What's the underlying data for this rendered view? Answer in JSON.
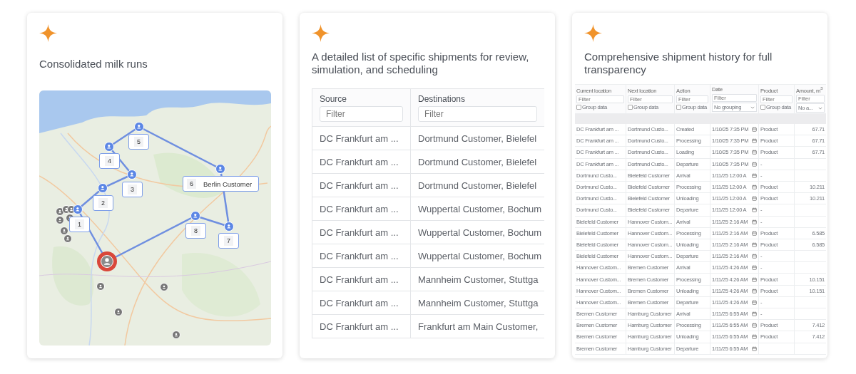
{
  "cards": [
    {
      "kind": "map",
      "title": "Consolidated milk runs",
      "map": {
        "stops": [
          {
            "label": "1"
          },
          {
            "label": "2"
          },
          {
            "label": "3"
          },
          {
            "label": "4"
          },
          {
            "label": "5"
          },
          {
            "label": "6",
            "name": "Berlin Customer"
          },
          {
            "label": "7"
          },
          {
            "label": "8"
          }
        ]
      }
    },
    {
      "kind": "list",
      "title": "A detailed list of specific shipments for review, simulation, and scheduling",
      "table": {
        "columns": [
          {
            "title": "Source",
            "placeholder": "Filter"
          },
          {
            "title": "Destinations",
            "placeholder": "Filter"
          }
        ],
        "rows": [
          [
            "DC Frankfurt am ...",
            "Dortmund Customer, Bielefel"
          ],
          [
            "DC Frankfurt am ...",
            "Dortmund Customer, Bielefel"
          ],
          [
            "DC Frankfurt am ...",
            "Dortmund Customer, Bielefel"
          ],
          [
            "DC Frankfurt am ...",
            "Wuppertal Customer, Bochum"
          ],
          [
            "DC Frankfurt am ...",
            "Wuppertal Customer, Bochum"
          ],
          [
            "DC Frankfurt am ...",
            "Wuppertal Customer, Bochum"
          ],
          [
            "DC Frankfurt am ...",
            "Mannheim Customer, Stuttga"
          ],
          [
            "DC Frankfurt am ...",
            "Mannheim Customer, Stuttga"
          ],
          [
            "DC Frankfurt am ...",
            "Frankfurt am Main Customer,"
          ]
        ]
      }
    },
    {
      "kind": "history",
      "title": "Comprehensive shipment history for full transparency",
      "table": {
        "columns": [
          {
            "title": "Current location",
            "placeholder": "Filter",
            "kind": "checkbox",
            "option": "Group data",
            "checked": false
          },
          {
            "title": "Next location",
            "placeholder": "Filter",
            "kind": "checkbox",
            "option": "Group data",
            "checked": false
          },
          {
            "title": "Action",
            "placeholder": "Filter",
            "kind": "checkbox",
            "option": "Group data",
            "checked": false
          },
          {
            "title": "Date",
            "placeholder": "Filter",
            "kind": "select",
            "option": "No grouping"
          },
          {
            "title": "Product",
            "placeholder": "Filter",
            "kind": "checkbox",
            "option": "Group data",
            "checked": false
          },
          {
            "title": "Amount, m$^{3}$",
            "placeholder": "Filter",
            "kind": "select",
            "option": "No a..."
          }
        ],
        "rows": [
          [
            "DC Frankfurt am ...",
            "Dortmund Custo...",
            "Created",
            "1/10/25 7:35 PM",
            "Product",
            "67.71"
          ],
          [
            "DC Frankfurt am ...",
            "Dortmund Custo...",
            "Processing",
            "1/10/25 7:35 PM",
            "Product",
            "67.71"
          ],
          [
            "DC Frankfurt am ...",
            "Dortmund Custo...",
            "Loading",
            "1/10/25 7:35 PM",
            "Product",
            "67.71"
          ],
          [
            "DC Frankfurt am ...",
            "Dortmund Custo...",
            "Departure",
            "1/10/25 7:35 PM",
            "-"
          ],
          [
            "Dortmund Custo...",
            "Bielefeld Customer",
            "Arrival",
            "1/11/25 12:00 A",
            "-"
          ],
          [
            "Dortmund Custo...",
            "Bielefeld Customer",
            "Processing",
            "1/11/25 12:00 A",
            "Product",
            "10.211"
          ],
          [
            "Dortmund Custo...",
            "Bielefeld Customer",
            "Unloading",
            "1/11/25 12:00 A",
            "Product",
            "10.211"
          ],
          [
            "Dortmund Custo...",
            "Bielefeld Customer",
            "Departure",
            "1/11/25 12:00 A",
            "-"
          ],
          [
            "Bielefeld Customer",
            "Hannover Custom...",
            "Arrival",
            "1/11/25 2:16 AM",
            "-"
          ],
          [
            "Bielefeld Customer",
            "Hannover Custom...",
            "Processing",
            "1/11/25 2:16 AM",
            "Product",
            "6.585"
          ],
          [
            "Bielefeld Customer",
            "Hannover Custom...",
            "Unloading",
            "1/11/25 2:16 AM",
            "Product",
            "6.585"
          ],
          [
            "Bielefeld Customer",
            "Hannover Custom...",
            "Departure",
            "1/11/25 2:16 AM",
            "-"
          ],
          [
            "Hannover Custom...",
            "Bremen Customer",
            "Arrival",
            "1/11/25 4:26 AM",
            "-"
          ],
          [
            "Hannover Custom...",
            "Bremen Customer",
            "Processing",
            "1/11/25 4:26 AM",
            "Product",
            "10.151"
          ],
          [
            "Hannover Custom...",
            "Bremen Customer",
            "Unloading",
            "1/11/25 4:26 AM",
            "Product",
            "10.151"
          ],
          [
            "Hannover Custom...",
            "Bremen Customer",
            "Departure",
            "1/11/25 4:26 AM",
            "-"
          ],
          [
            "Bremen Customer",
            "Hamburg Customer",
            "Arrival",
            "1/11/25 6:55 AM",
            "-"
          ],
          [
            "Bremen Customer",
            "Hamburg Customer",
            "Processing",
            "1/11/25 6:55 AM",
            "Product",
            "7.412"
          ],
          [
            "Bremen Customer",
            "Hamburg Customer",
            "Unloading",
            "1/11/25 6:55 AM",
            "Product",
            "7.412"
          ],
          [
            "Bremen Customer",
            "Hamburg Customer",
            "Departure",
            "1/11/25 6:55 AM"
          ]
        ]
      }
    }
  ]
}
